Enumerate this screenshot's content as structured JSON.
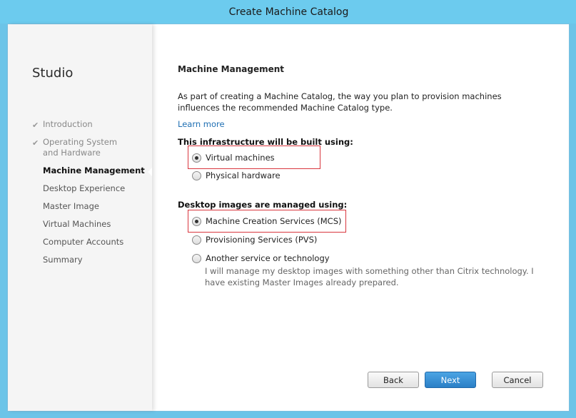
{
  "window": {
    "title": "Create Machine Catalog"
  },
  "sidebar": {
    "brand": "Studio",
    "steps": [
      {
        "label": "Introduction",
        "state": "done"
      },
      {
        "label": "Operating System and Hardware",
        "state": "done"
      },
      {
        "label": "Machine Management",
        "state": "current"
      },
      {
        "label": "Desktop Experience",
        "state": "pending"
      },
      {
        "label": "Master Image",
        "state": "pending"
      },
      {
        "label": "Virtual Machines",
        "state": "pending"
      },
      {
        "label": "Computer Accounts",
        "state": "pending"
      },
      {
        "label": "Summary",
        "state": "pending"
      }
    ]
  },
  "main": {
    "title": "Machine Management",
    "intro": "As part of creating a Machine Catalog, the way you plan to provision machines influences the recommended Machine Catalog type.",
    "learn_more": "Learn more",
    "infrastructure": {
      "label": "This infrastructure will be built using:",
      "options": [
        {
          "label": "Virtual machines",
          "selected": true
        },
        {
          "label": "Physical hardware",
          "selected": false
        }
      ]
    },
    "images": {
      "label": "Desktop images are managed using:",
      "options": [
        {
          "label": "Machine Creation Services (MCS)",
          "selected": true
        },
        {
          "label": "Provisioning Services (PVS)",
          "selected": false
        },
        {
          "label": "Another service or technology",
          "selected": false
        }
      ],
      "other_description": "I will manage my desktop images with something other than Citrix technology. I have existing Master Images already prepared."
    }
  },
  "buttons": {
    "back": "Back",
    "next": "Next",
    "cancel": "Cancel"
  },
  "colors": {
    "titlebar": "#6ccbee",
    "accent": "#2b7fc6",
    "link": "#1f6fb3",
    "highlight": "#d9363e"
  }
}
